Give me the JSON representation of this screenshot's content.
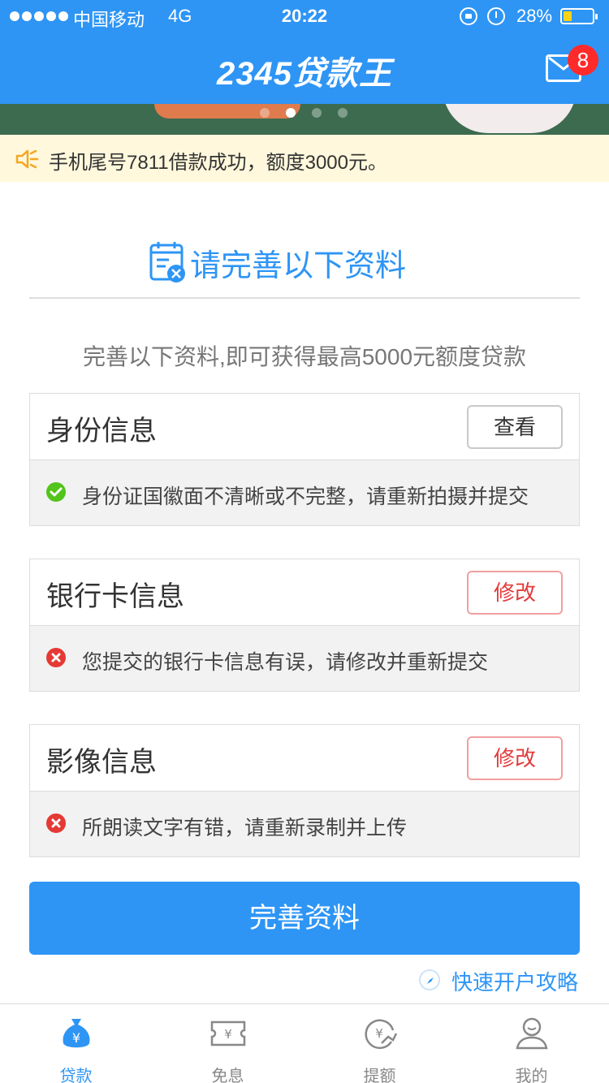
{
  "status_bar": {
    "carrier": "中国移动",
    "network": "4G",
    "time": "20:22",
    "battery_percent": "28%",
    "battery_level": 0.28
  },
  "header": {
    "logo_text": "2345贷款王",
    "mail_badge": "8"
  },
  "banner": {
    "page_count": 4,
    "active_page": 2
  },
  "notice": {
    "text": "手机尾号7811借款成功，额度3000元。"
  },
  "section": {
    "title": "请完善以下资料",
    "subtitle": "完善以下资料,即可获得最高5000元额度贷款"
  },
  "cards": [
    {
      "label": "身份信息",
      "button": "查看",
      "status": "ok",
      "message": "身份证国徽面不清晰或不完整，请重新拍摄并提交"
    },
    {
      "label": "银行卡信息",
      "button": "修改",
      "status": "error",
      "message": "您提交的银行卡信息有误，请修改并重新提交"
    },
    {
      "label": "影像信息",
      "button": "修改",
      "status": "error",
      "message": "所朗读文字有错，请重新录制并上传"
    }
  ],
  "actions": {
    "submit_label": "完善资料",
    "guide_label": "快速开户攻略"
  },
  "tabs": [
    {
      "label": "贷款",
      "icon": "money-bag-icon",
      "active": true
    },
    {
      "label": "免息",
      "icon": "ticket-icon",
      "active": false
    },
    {
      "label": "提额",
      "icon": "raise-limit-icon",
      "active": false
    },
    {
      "label": "我的",
      "icon": "profile-icon",
      "active": false
    }
  ],
  "colors": {
    "primary": "#2e95f5",
    "error": "#e53935",
    "success": "#52c41a",
    "notice_bg": "#fff8dc"
  }
}
